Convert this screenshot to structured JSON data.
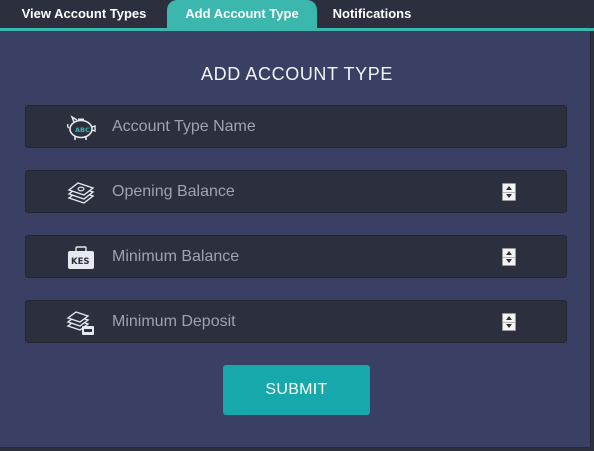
{
  "tabs": {
    "view_account_types": "View Account Types",
    "add_account_type": "Add Account Type",
    "notifications": "Notifications"
  },
  "form": {
    "title": "ADD ACCOUNT TYPE",
    "account_type_name": {
      "placeholder": "Account Type Name",
      "icon": "piggy-bank-abc-icon"
    },
    "opening_balance": {
      "placeholder": "Opening Balance",
      "icon": "money-stack-icon"
    },
    "minimum_balance": {
      "placeholder": "Minimum Balance",
      "icon": "kes-wallet-icon"
    },
    "minimum_deposit": {
      "placeholder": "Minimum Deposit",
      "icon": "money-deposit-icon"
    },
    "submit_label": "SUBMIT"
  },
  "colors": {
    "accent": "#3bb7ad",
    "panel": "#3a4063",
    "field_bg": "#2b2f3e",
    "submit": "#17a8ac"
  }
}
